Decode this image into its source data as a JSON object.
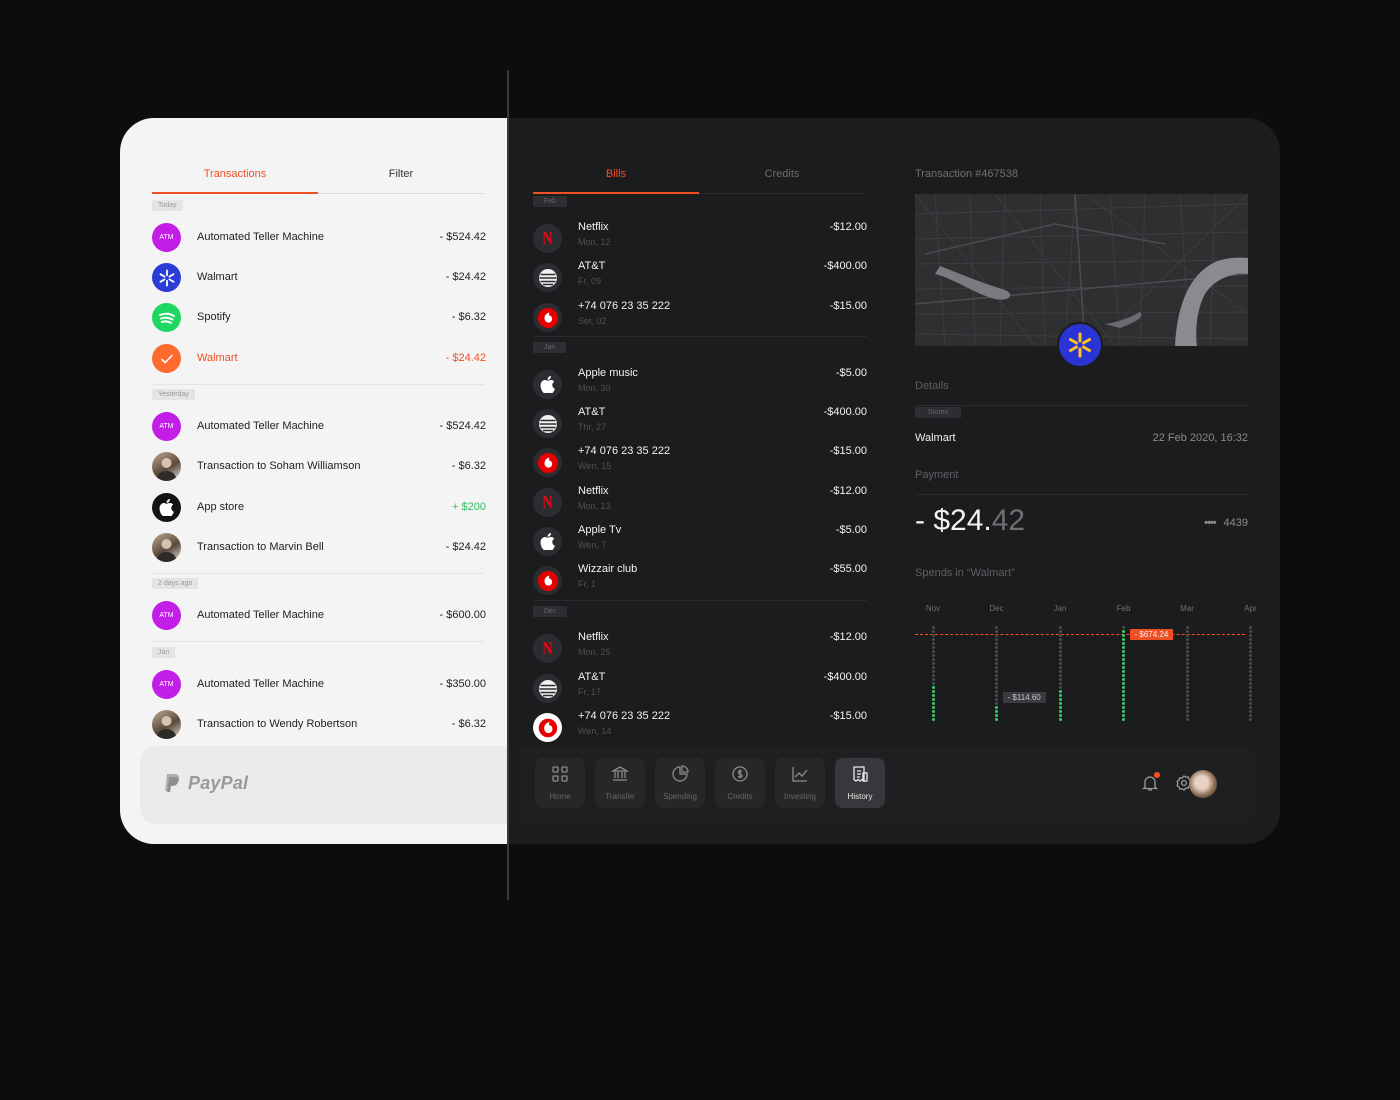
{
  "colors": {
    "accent": "#f04e23",
    "positive": "#2fbf5d",
    "dark_bg": "#1b1c1e",
    "light_bg": "#f4f4f4"
  },
  "light": {
    "tabs": {
      "active": "Transactions",
      "other": "Filter"
    },
    "groups": [
      {
        "label": "Today",
        "items": [
          {
            "icon": "atm-icon",
            "icon_text": "ATM",
            "name": "Automated Teller Machine",
            "amount": "- $524.42"
          },
          {
            "icon": "walmart-icon",
            "name": "Walmart",
            "amount": "- $24.42"
          },
          {
            "icon": "spotify-icon",
            "name": "Spotify",
            "amount": "- $6.32"
          },
          {
            "icon": "check-icon",
            "name": "Walmart",
            "amount": "- $24.42",
            "selected": true
          }
        ]
      },
      {
        "label": "Yesterday",
        "items": [
          {
            "icon": "atm-icon",
            "icon_text": "ATM",
            "name": "Automated Teller Machine",
            "amount": "- $524.42"
          },
          {
            "icon": "avatar-icon",
            "name": "Transaction to Soham Williamson",
            "amount": "- $6.32"
          },
          {
            "icon": "apple-icon",
            "name": "App store",
            "amount": "+ $200"
          },
          {
            "icon": "avatar-icon",
            "name": "Transaction to Marvin Bell",
            "amount": "- $24.42"
          }
        ]
      },
      {
        "label": "2 days ago",
        "items": [
          {
            "icon": "atm-icon",
            "icon_text": "ATM",
            "name": "Automated Teller Machine",
            "amount": "- $600.00"
          }
        ]
      },
      {
        "label": "Jan",
        "items": [
          {
            "icon": "atm-icon",
            "icon_text": "ATM",
            "name": "Automated Teller Machine",
            "amount": "- $350.00"
          },
          {
            "icon": "avatar-icon",
            "name": "Transaction to Wendy Robertson",
            "amount": "- $6.32"
          }
        ]
      }
    ],
    "paypal": "PayPal"
  },
  "dark": {
    "tabs": {
      "active": "Bills",
      "other": "Credits"
    },
    "groups": [
      {
        "label": "Feb",
        "items": [
          {
            "icon": "netflix-icon",
            "name": "Netflix",
            "date": "Mon, 12",
            "amount": "-$12.00"
          },
          {
            "icon": "att-icon",
            "name": "AT&T",
            "date": "Fr, 09",
            "amount": "-$400.00"
          },
          {
            "icon": "vodafone-icon",
            "name": "+74 076 23 35 222",
            "date": "Set, 02",
            "amount": "-$15.00"
          }
        ]
      },
      {
        "label": "Jan",
        "items": [
          {
            "icon": "apple-icon",
            "name": "Apple music",
            "date": "Mon, 30",
            "amount": "-$5.00"
          },
          {
            "icon": "att-icon",
            "name": "AT&T",
            "date": "Thr, 27",
            "amount": "-$400.00"
          },
          {
            "icon": "vodafone-icon",
            "name": "+74 076 23 35 222",
            "date": "Wen, 15",
            "amount": "-$15.00"
          },
          {
            "icon": "netflix-icon",
            "name": "Netflix",
            "date": "Mon, 13",
            "amount": "-$12.00"
          },
          {
            "icon": "apple-icon",
            "name": "Apple Tv",
            "date": "Wen, 7",
            "amount": "-$5.00"
          },
          {
            "icon": "vodafone-icon",
            "name": "Wizzair club",
            "date": "Fr, 1",
            "amount": "-$55.00"
          }
        ]
      },
      {
        "label": "Dec",
        "items": [
          {
            "icon": "netflix-icon",
            "name": "Netflix",
            "date": "Mon, 25",
            "amount": "-$12.00"
          },
          {
            "icon": "att-icon",
            "name": "AT&T",
            "date": "Fr, 17",
            "amount": "-$400.00"
          },
          {
            "icon": "vodafone-icon",
            "name": "+74 076 23 35 222",
            "date": "Wen, 14",
            "amount": "-$15.00",
            "white_icon": true
          }
        ]
      }
    ],
    "detail": {
      "title": "Transaction #467538",
      "details_label": "Details",
      "stores_tag": "Stores",
      "store_name": "Walmart",
      "store_date": "22 Feb 2020, 16:32",
      "payment_label": "Payment",
      "amount_main": "- $24.",
      "amount_cents": "42",
      "card_dots": "••••",
      "card_last4": "4439",
      "spends_label": "Spends in “Walmart”"
    },
    "nav": [
      {
        "label": "Home",
        "icon": "grid-icon"
      },
      {
        "label": "Transfer",
        "icon": "bank-icon"
      },
      {
        "label": "Spending",
        "icon": "pie-icon"
      },
      {
        "label": "Credits",
        "icon": "dollar-cycle-icon"
      },
      {
        "label": "Investing",
        "icon": "line-chart-icon"
      },
      {
        "label": "History",
        "icon": "receipt-icon",
        "active": true
      }
    ]
  },
  "chart_data": {
    "type": "bar",
    "categories": [
      "Nov",
      "Dec",
      "Jan",
      "Feb",
      "Mar",
      "Apr"
    ],
    "values": [
      0.36,
      0.15,
      0.33,
      0.95,
      0,
      0
    ],
    "annotations": [
      {
        "category": "Feb",
        "label": "- $674.24"
      },
      {
        "category": "Dec",
        "label": "- $114.60"
      }
    ]
  }
}
